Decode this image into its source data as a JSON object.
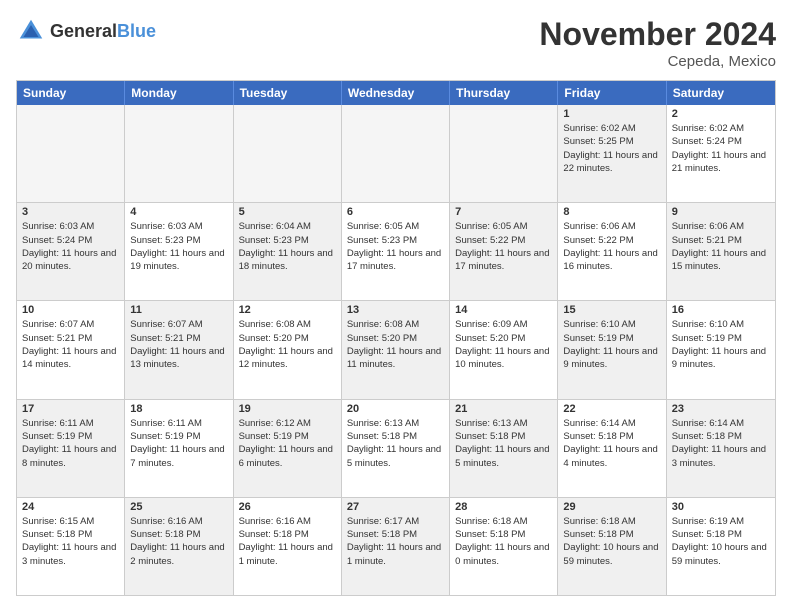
{
  "logo": {
    "text_general": "General",
    "text_blue": "Blue"
  },
  "title": "November 2024",
  "location": "Cepeda, Mexico",
  "headers": [
    "Sunday",
    "Monday",
    "Tuesday",
    "Wednesday",
    "Thursday",
    "Friday",
    "Saturday"
  ],
  "rows": [
    [
      {
        "day": "",
        "info": "",
        "empty": true
      },
      {
        "day": "",
        "info": "",
        "empty": true
      },
      {
        "day": "",
        "info": "",
        "empty": true
      },
      {
        "day": "",
        "info": "",
        "empty": true
      },
      {
        "day": "",
        "info": "",
        "empty": true
      },
      {
        "day": "1",
        "info": "Sunrise: 6:02 AM\nSunset: 5:25 PM\nDaylight: 11 hours and 22 minutes.",
        "shaded": true
      },
      {
        "day": "2",
        "info": "Sunrise: 6:02 AM\nSunset: 5:24 PM\nDaylight: 11 hours and 21 minutes.",
        "shaded": false
      }
    ],
    [
      {
        "day": "3",
        "info": "Sunrise: 6:03 AM\nSunset: 5:24 PM\nDaylight: 11 hours and 20 minutes.",
        "shaded": true
      },
      {
        "day": "4",
        "info": "Sunrise: 6:03 AM\nSunset: 5:23 PM\nDaylight: 11 hours and 19 minutes.",
        "shaded": false
      },
      {
        "day": "5",
        "info": "Sunrise: 6:04 AM\nSunset: 5:23 PM\nDaylight: 11 hours and 18 minutes.",
        "shaded": true
      },
      {
        "day": "6",
        "info": "Sunrise: 6:05 AM\nSunset: 5:23 PM\nDaylight: 11 hours and 17 minutes.",
        "shaded": false
      },
      {
        "day": "7",
        "info": "Sunrise: 6:05 AM\nSunset: 5:22 PM\nDaylight: 11 hours and 17 minutes.",
        "shaded": true
      },
      {
        "day": "8",
        "info": "Sunrise: 6:06 AM\nSunset: 5:22 PM\nDaylight: 11 hours and 16 minutes.",
        "shaded": false
      },
      {
        "day": "9",
        "info": "Sunrise: 6:06 AM\nSunset: 5:21 PM\nDaylight: 11 hours and 15 minutes.",
        "shaded": true
      }
    ],
    [
      {
        "day": "10",
        "info": "Sunrise: 6:07 AM\nSunset: 5:21 PM\nDaylight: 11 hours and 14 minutes.",
        "shaded": false
      },
      {
        "day": "11",
        "info": "Sunrise: 6:07 AM\nSunset: 5:21 PM\nDaylight: 11 hours and 13 minutes.",
        "shaded": true
      },
      {
        "day": "12",
        "info": "Sunrise: 6:08 AM\nSunset: 5:20 PM\nDaylight: 11 hours and 12 minutes.",
        "shaded": false
      },
      {
        "day": "13",
        "info": "Sunrise: 6:08 AM\nSunset: 5:20 PM\nDaylight: 11 hours and 11 minutes.",
        "shaded": true
      },
      {
        "day": "14",
        "info": "Sunrise: 6:09 AM\nSunset: 5:20 PM\nDaylight: 11 hours and 10 minutes.",
        "shaded": false
      },
      {
        "day": "15",
        "info": "Sunrise: 6:10 AM\nSunset: 5:19 PM\nDaylight: 11 hours and 9 minutes.",
        "shaded": true
      },
      {
        "day": "16",
        "info": "Sunrise: 6:10 AM\nSunset: 5:19 PM\nDaylight: 11 hours and 9 minutes.",
        "shaded": false
      }
    ],
    [
      {
        "day": "17",
        "info": "Sunrise: 6:11 AM\nSunset: 5:19 PM\nDaylight: 11 hours and 8 minutes.",
        "shaded": true
      },
      {
        "day": "18",
        "info": "Sunrise: 6:11 AM\nSunset: 5:19 PM\nDaylight: 11 hours and 7 minutes.",
        "shaded": false
      },
      {
        "day": "19",
        "info": "Sunrise: 6:12 AM\nSunset: 5:19 PM\nDaylight: 11 hours and 6 minutes.",
        "shaded": true
      },
      {
        "day": "20",
        "info": "Sunrise: 6:13 AM\nSunset: 5:18 PM\nDaylight: 11 hours and 5 minutes.",
        "shaded": false
      },
      {
        "day": "21",
        "info": "Sunrise: 6:13 AM\nSunset: 5:18 PM\nDaylight: 11 hours and 5 minutes.",
        "shaded": true
      },
      {
        "day": "22",
        "info": "Sunrise: 6:14 AM\nSunset: 5:18 PM\nDaylight: 11 hours and 4 minutes.",
        "shaded": false
      },
      {
        "day": "23",
        "info": "Sunrise: 6:14 AM\nSunset: 5:18 PM\nDaylight: 11 hours and 3 minutes.",
        "shaded": true
      }
    ],
    [
      {
        "day": "24",
        "info": "Sunrise: 6:15 AM\nSunset: 5:18 PM\nDaylight: 11 hours and 3 minutes.",
        "shaded": false
      },
      {
        "day": "25",
        "info": "Sunrise: 6:16 AM\nSunset: 5:18 PM\nDaylight: 11 hours and 2 minutes.",
        "shaded": true
      },
      {
        "day": "26",
        "info": "Sunrise: 6:16 AM\nSunset: 5:18 PM\nDaylight: 11 hours and 1 minute.",
        "shaded": false
      },
      {
        "day": "27",
        "info": "Sunrise: 6:17 AM\nSunset: 5:18 PM\nDaylight: 11 hours and 1 minute.",
        "shaded": true
      },
      {
        "day": "28",
        "info": "Sunrise: 6:18 AM\nSunset: 5:18 PM\nDaylight: 11 hours and 0 minutes.",
        "shaded": false
      },
      {
        "day": "29",
        "info": "Sunrise: 6:18 AM\nSunset: 5:18 PM\nDaylight: 10 hours and 59 minutes.",
        "shaded": true
      },
      {
        "day": "30",
        "info": "Sunrise: 6:19 AM\nSunset: 5:18 PM\nDaylight: 10 hours and 59 minutes.",
        "shaded": false
      }
    ]
  ]
}
